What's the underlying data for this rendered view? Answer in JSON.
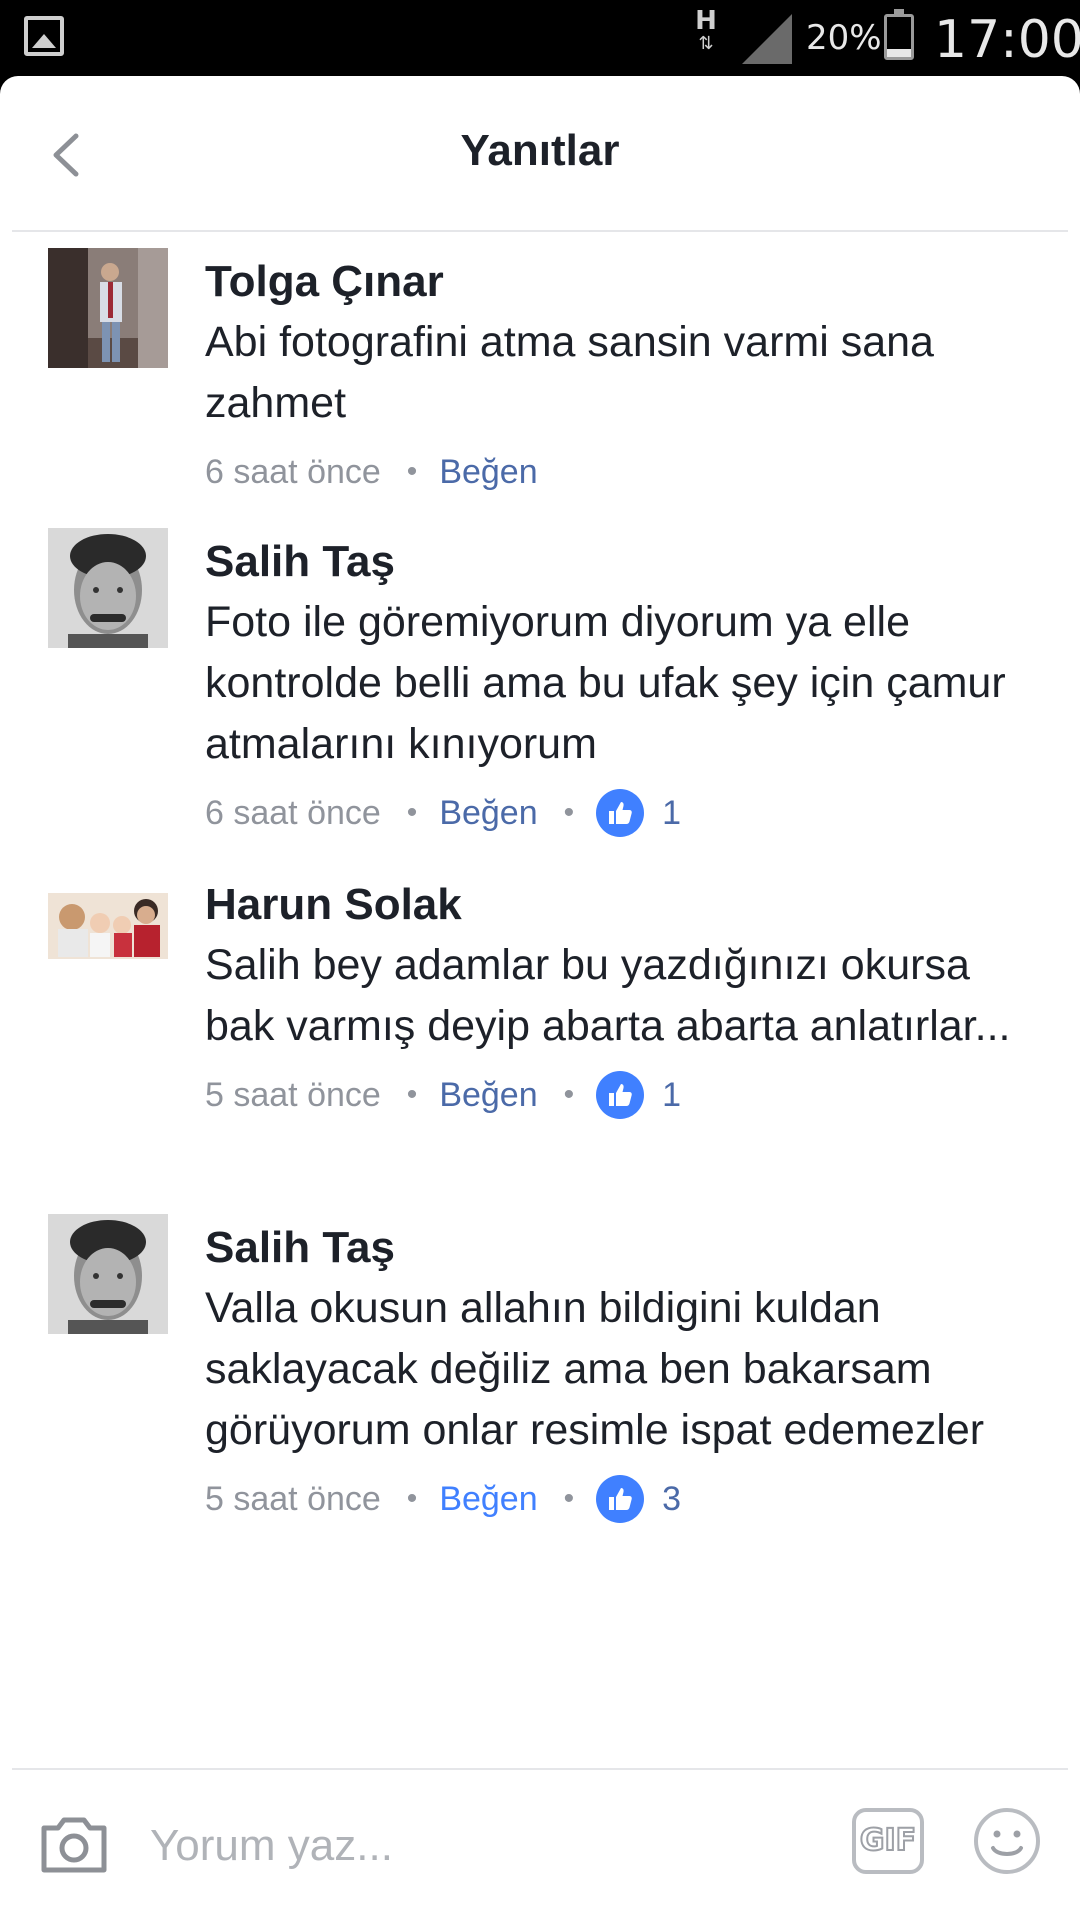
{
  "status_bar": {
    "network": "H",
    "battery_text": "20%",
    "battery_level": 0.2,
    "time": "17:00",
    "icons": [
      "gallery-icon",
      "data-transfer-icon",
      "signal-icon",
      "battery-icon"
    ]
  },
  "header": {
    "title": "Yanıtlar",
    "back_icon": "chevron-left-icon"
  },
  "comments": [
    {
      "author": "Tolga Çınar",
      "text": "Abi fotografini atma sansin varmi sana zahmet",
      "time": "6 saat önce",
      "like_label": "Beğen",
      "likes": null
    },
    {
      "author": "Salih Taş",
      "text": "Foto ile göremiyorum diyorum ya elle kontrolde belli ama bu ufak şey için çamur atmalarını kınıyorum",
      "time": "6 saat önce",
      "like_label": "Beğen",
      "likes": "1"
    },
    {
      "author": "Harun Solak",
      "text": "Salih bey adamlar bu yazdığınızı okursa bak varmış deyip abarta abarta anlatırlar...",
      "time": "5 saat önce",
      "like_label": "Beğen",
      "likes": "1"
    },
    {
      "author": "Salih Taş",
      "text": "Valla okusun allahın bildigini kuldan saklayacak değiliz ama ben bakarsam görüyorum onlar resimle ispat edemezler",
      "time": "5 saat önce",
      "like_label": "Beğen",
      "likes": "3"
    }
  ],
  "composer": {
    "placeholder": "Yorum yaz...",
    "gif_label": "GIF",
    "icons": [
      "camera-icon",
      "gif-icon",
      "emoji-icon"
    ]
  },
  "colors": {
    "text_primary": "#1d2129",
    "text_secondary": "#90949c",
    "link": "#4b6aa8",
    "like_blue": "#4080ff",
    "divider": "#e5e6e9"
  }
}
